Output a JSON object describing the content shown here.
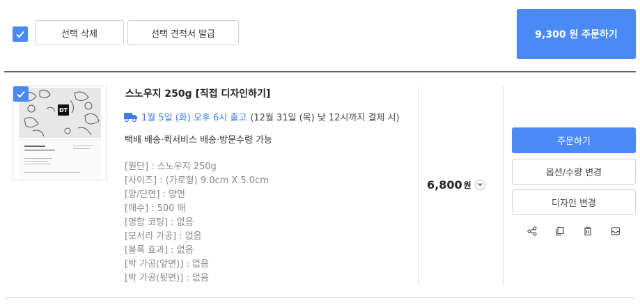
{
  "toolbar": {
    "delete_selected_label": "선택 삭제",
    "issue_quote_label": "선택 견적서 발급",
    "order_total_label": "9,300 원 주문하기"
  },
  "item": {
    "title": "스노우지 250g [직접 디자인하기]",
    "delivery_date": "1월 5일 (화) 오후 6시 출고",
    "delivery_condition": "(12월 31일 (목) 낮 12시까지 결제 시)",
    "shipping_methods": "택배 배송·퀵서비스 배송·방문수령 가능",
    "options": [
      "[원단] : 스노우지 250g",
      "[사이즈] : (가로형) 9.0cm X 5.0cm",
      "[양/단면] : 양면",
      "[매수] : 500 매",
      "[명함 코팅] : 없음",
      "[모서리 가공] : 없음",
      "[볼록 효과] : 없음",
      "[박 가공(앞면)] : 없음",
      "[박 가공(뒷면)] : 없음"
    ],
    "price": "6,800",
    "price_unit": "원",
    "thumbnail_logo": "DT"
  },
  "actions": {
    "order_label": "주문하기",
    "change_options_label": "옵션/수량 변경",
    "change_design_label": "디자인 변경"
  },
  "icons": {
    "checkbox": "check-icon",
    "delivery": "truck-icon",
    "price_toggle": "chevron-down-icon",
    "share": "share-icon",
    "copy": "copy-icon",
    "delete": "trash-icon",
    "save": "inbox-icon"
  },
  "colors": {
    "accent": "#4a8af4",
    "delivery_text": "#3e7ce8",
    "option_text": "#888888"
  }
}
